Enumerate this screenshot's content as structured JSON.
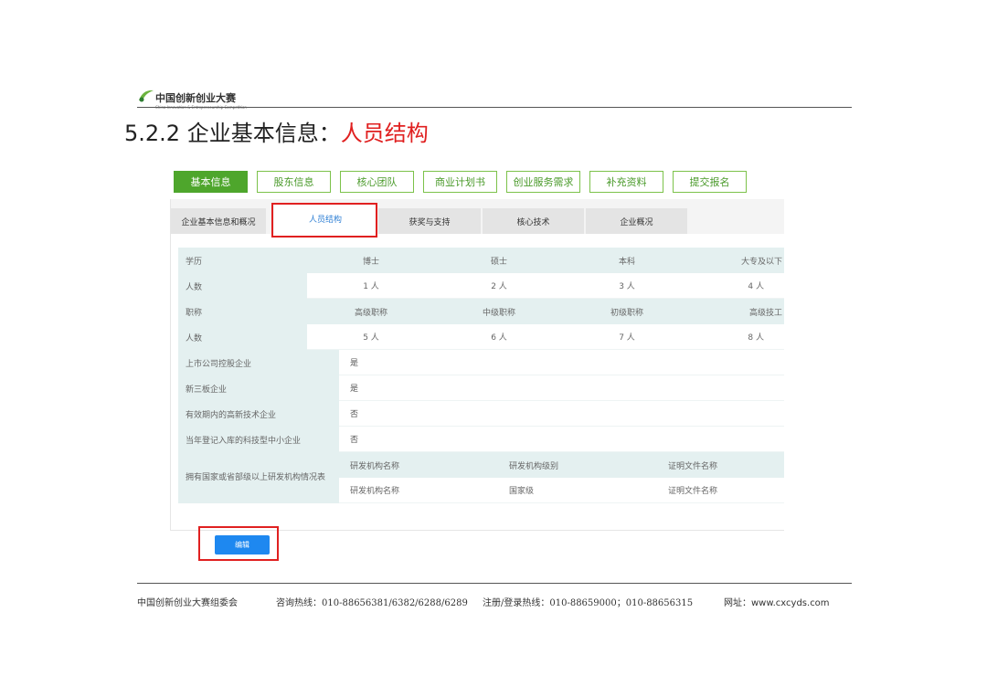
{
  "header": {
    "logo_text": "中国创新创业大赛",
    "logo_subtext": "China Innovation & Entrepreneurship Competition"
  },
  "section": {
    "number": "5.2.2",
    "title_prefix": "企业基本信息：",
    "title_highlight": "人员结构"
  },
  "main_tabs": [
    "基本信息",
    "股东信息",
    "核心团队",
    "商业计划书",
    "创业服务需求",
    "补充资料",
    "提交报名"
  ],
  "sub_tabs": [
    "企业基本信息和概况",
    "人员结构",
    "获奖与支持",
    "核心技术",
    "企业概况"
  ],
  "education": {
    "label": "学历",
    "headers": [
      "博士",
      "硕士",
      "本科",
      "大专及以下"
    ],
    "count_label": "人数",
    "counts": [
      "1 人",
      "2 人",
      "3 人",
      "4 人"
    ]
  },
  "titles": {
    "label": "职称",
    "headers": [
      "高级职称",
      "中级职称",
      "初级职称",
      "高级技工"
    ],
    "count_label": "人数",
    "counts": [
      "5 人",
      "6 人",
      "7 人",
      "8 人"
    ]
  },
  "flags": [
    {
      "label": "上市公司控股企业",
      "value": "是"
    },
    {
      "label": "新三板企业",
      "value": "是"
    },
    {
      "label": "有效期内的高新技术企业",
      "value": "否"
    },
    {
      "label": "当年登记入库的科技型中小企业",
      "value": "否"
    }
  ],
  "rnd": {
    "label": "拥有国家或省部级以上研发机构情况表",
    "headers": [
      "研发机构名称",
      "研发机构级别",
      "证明文件名称"
    ],
    "values": [
      "研发机构名称",
      "国家级",
      "证明文件名称"
    ]
  },
  "edit_button": "编辑",
  "footer": {
    "org": "中国创新创业大赛组委会",
    "hotline": "咨询热线：010-88656381/6382/6288/6289",
    "register": "注册/登录热线：010-88659000；010-88656315",
    "site": "网址：www.cxcyds.com"
  },
  "colors": {
    "accent_green": "#4ea62c",
    "highlight_red": "#e02020",
    "button_blue": "#1e88f0",
    "table_teal": "#e4f0f0"
  }
}
